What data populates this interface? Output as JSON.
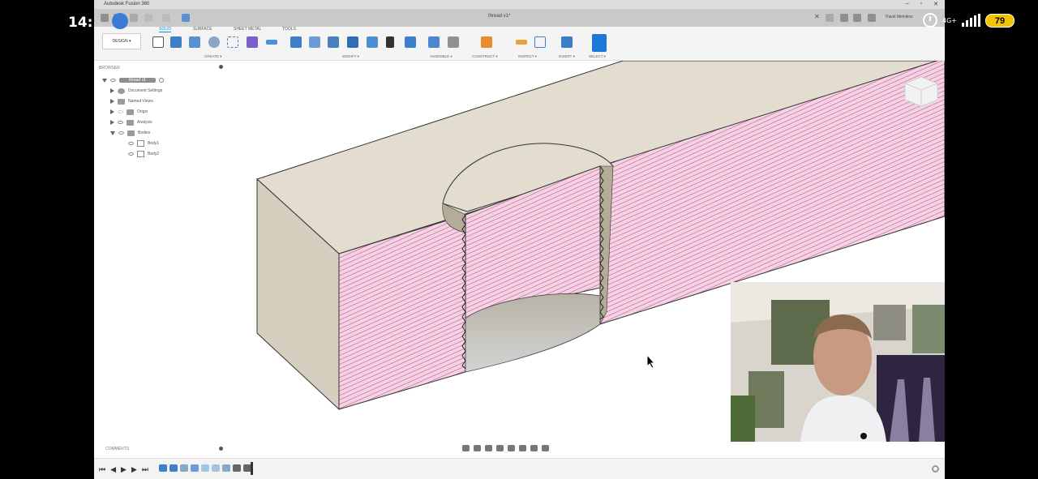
{
  "phone": {
    "time": "14:15",
    "network": "4G+",
    "battery": "79"
  },
  "app": {
    "title": "Autodesk Fusion 360",
    "document_tab": "thread v1*",
    "user": "Pavel Melnikov",
    "design_button": "DESIGN ▾",
    "workspace_tabs": [
      "SOLID",
      "SURFACE",
      "SHEET METAL",
      "TOOLS"
    ],
    "toolbar_groups": [
      "CREATE ▾",
      "MODIFY ▾",
      "ASSEMBLE ▾",
      "CONSTRUCT ▾",
      "INSPECT ▾",
      "INSERT ▾",
      "SELECT ▾"
    ]
  },
  "browser": {
    "header": "BROWSER",
    "root": "thread v1",
    "items": [
      "Document Settings",
      "Named Views",
      "Origin",
      "Analysis",
      "Bodies"
    ],
    "bodies": [
      "Body1",
      "Body2"
    ]
  },
  "comments": {
    "label": "COMMENTS"
  },
  "colors": {
    "section_hatch": "#e8a3c8",
    "body_face": "#e3ddd0",
    "body_side": "#d6cfc0",
    "accent": "#0696d7"
  }
}
